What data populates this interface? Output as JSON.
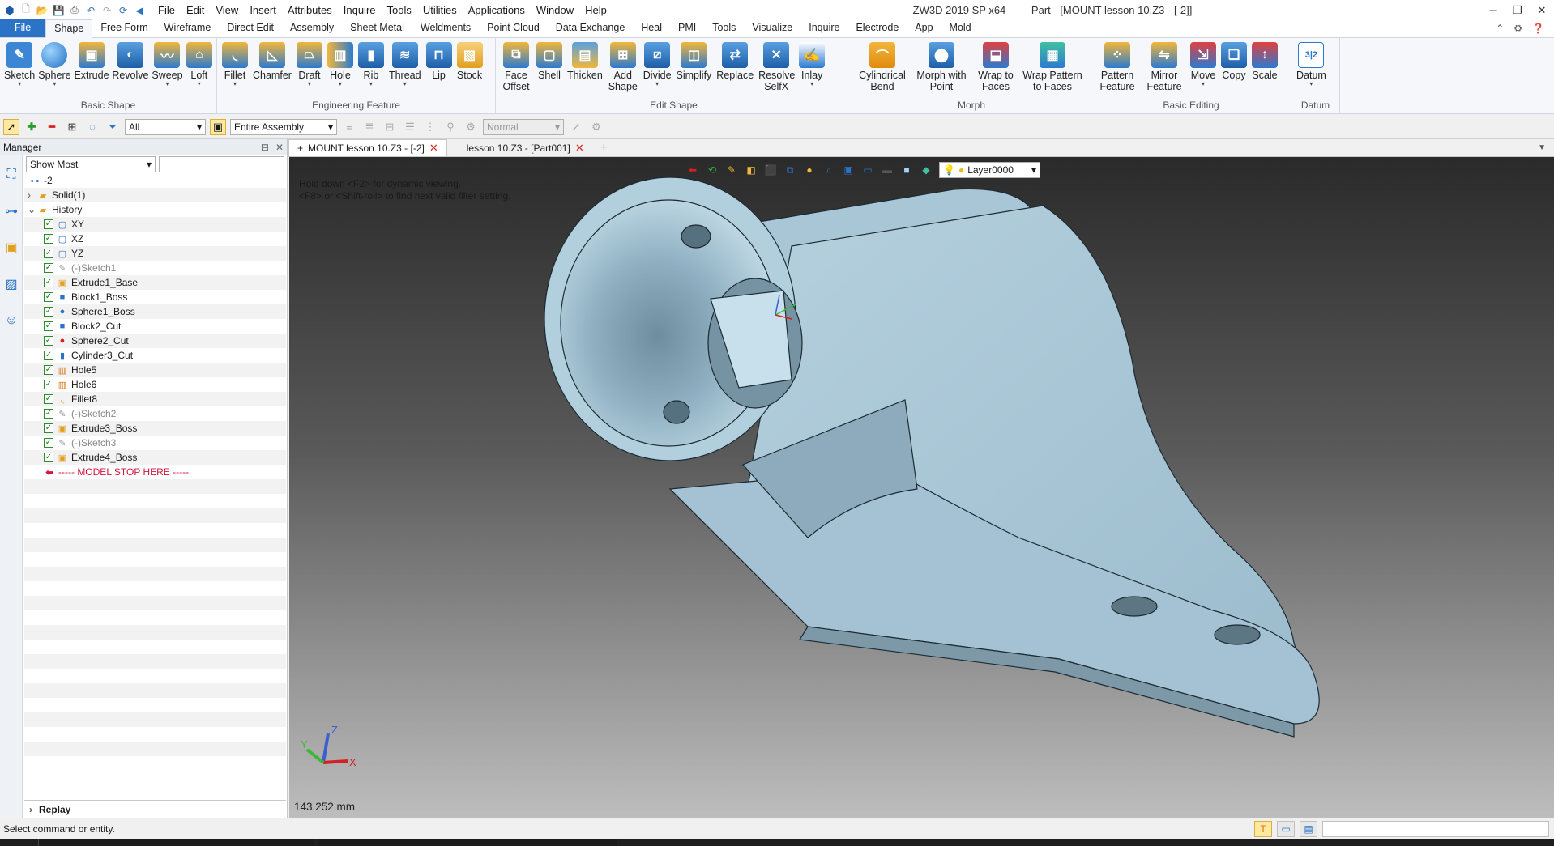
{
  "title_bar": {
    "app_version": "ZW3D 2019 SP x64",
    "doc_title": "Part - [MOUNT lesson 10.Z3 - [-2]]",
    "menu": [
      "File",
      "Edit",
      "View",
      "Insert",
      "Attributes",
      "Inquire",
      "Tools",
      "Utilities",
      "Applications",
      "Window",
      "Help"
    ]
  },
  "ribbon_tabs": [
    "File",
    "Shape",
    "Free Form",
    "Wireframe",
    "Direct Edit",
    "Assembly",
    "Sheet Metal",
    "Weldments",
    "Point Cloud",
    "Data Exchange",
    "Heal",
    "PMI",
    "Tools",
    "Visualize",
    "Inquire",
    "Electrode",
    "App",
    "Mold"
  ],
  "active_ribbon_tab": "Shape",
  "ribbon_groups": {
    "basic_shape": {
      "label": "Basic Shape",
      "buttons": [
        "Sketch",
        "Sphere",
        "Extrude",
        "Revolve",
        "Sweep",
        "Loft"
      ]
    },
    "engineering_feature": {
      "label": "Engineering Feature",
      "buttons": [
        "Fillet",
        "Chamfer",
        "Draft",
        "Hole",
        "Rib",
        "Thread",
        "Lip",
        "Stock"
      ]
    },
    "edit_shape": {
      "label": "Edit Shape",
      "buttons": [
        "Face Offset",
        "Shell",
        "Thicken",
        "Add Shape",
        "Divide",
        "Simplify",
        "Replace",
        "Resolve SelfX",
        "Inlay"
      ]
    },
    "morph": {
      "label": "Morph",
      "buttons": [
        "Cylindrical Bend",
        "Morph with Point",
        "Wrap to Faces",
        "Wrap Pattern to Faces"
      ]
    },
    "basic_editing": {
      "label": "Basic Editing",
      "buttons": [
        "Pattern Feature",
        "Mirror Feature",
        "Move",
        "Copy",
        "Scale"
      ]
    },
    "datum": {
      "label": "Datum",
      "buttons": [
        "Datum"
      ]
    }
  },
  "toolbar2": {
    "filter_combo": "All",
    "scope_combo": "Entire Assembly",
    "mode_combo": "Normal"
  },
  "manager": {
    "title": "Manager",
    "filter": "Show Most",
    "tree": [
      {
        "label": "-2",
        "icon": "assembly-icon",
        "level": 0,
        "check": false
      },
      {
        "label": "Solid(1)",
        "icon": "folder-icon",
        "level": 1,
        "check": false
      },
      {
        "label": "History",
        "icon": "folder-icon",
        "level": 1,
        "check": false
      },
      {
        "label": "XY",
        "icon": "plane-icon",
        "level": 2,
        "check": true
      },
      {
        "label": "XZ",
        "icon": "plane-icon",
        "level": 2,
        "check": true
      },
      {
        "label": "YZ",
        "icon": "plane-icon",
        "level": 2,
        "check": true
      },
      {
        "label": "(-)Sketch1",
        "icon": "sketch-icon",
        "level": 2,
        "check": true,
        "muted": true
      },
      {
        "label": "Extrude1_Base",
        "icon": "extrude-icon",
        "level": 2,
        "check": true
      },
      {
        "label": "Block1_Boss",
        "icon": "block-icon",
        "level": 2,
        "check": true
      },
      {
        "label": "Sphere1_Boss",
        "icon": "sphere-icon",
        "level": 2,
        "check": true
      },
      {
        "label": "Block2_Cut",
        "icon": "block-icon",
        "level": 2,
        "check": true
      },
      {
        "label": "Sphere2_Cut",
        "icon": "sphere-cut-icon",
        "level": 2,
        "check": true
      },
      {
        "label": "Cylinder3_Cut",
        "icon": "cylinder-icon",
        "level": 2,
        "check": true
      },
      {
        "label": "Hole5",
        "icon": "hole-icon",
        "level": 2,
        "check": true
      },
      {
        "label": "Hole6",
        "icon": "hole-icon",
        "level": 2,
        "check": true
      },
      {
        "label": "Fillet8",
        "icon": "fillet-icon",
        "level": 2,
        "check": true
      },
      {
        "label": "(-)Sketch2",
        "icon": "sketch-icon",
        "level": 2,
        "check": true,
        "muted": true
      },
      {
        "label": "Extrude3_Boss",
        "icon": "extrude-icon",
        "level": 2,
        "check": true
      },
      {
        "label": "(-)Sketch3",
        "icon": "sketch-icon",
        "level": 2,
        "check": true,
        "muted": true
      },
      {
        "label": "Extrude4_Boss",
        "icon": "extrude-icon",
        "level": 2,
        "check": true
      }
    ],
    "model_stop": "----- MODEL STOP HERE -----",
    "replay": "Replay"
  },
  "doc_tabs": [
    {
      "label": "MOUNT lesson 10.Z3 - [-2]",
      "active": true
    },
    {
      "label": "lesson 10.Z3 - [Part001]",
      "active": false
    }
  ],
  "viewport": {
    "hint_line1": "Hold down <F2> for dynamic viewing.",
    "hint_line2": "<F8> or <Shift-roll> to find next valid filter setting.",
    "layer": "Layer0000",
    "measure": "143.252 mm",
    "triad_labels": {
      "x": "X",
      "y": "Y",
      "z": "Z"
    }
  },
  "status": {
    "message": "Select command or entity."
  },
  "colors": {
    "file_tab": "#2b73c6",
    "model_face": "#a9c6d6",
    "model_edge": "#1c2a33",
    "stop_marker": "#d4143c"
  }
}
